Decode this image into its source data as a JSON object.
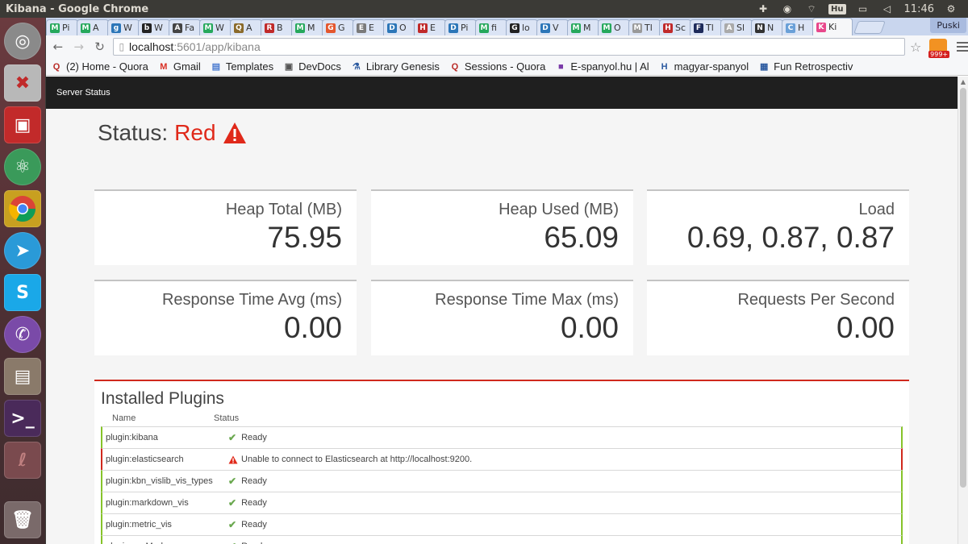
{
  "system_bar": {
    "window_title": "Kibana - Google Chrome",
    "keyboard_layout": "Hu",
    "time": "11:46"
  },
  "launcher": {
    "apps": [
      "ubuntu-icon",
      "settings-icon",
      "app-icon",
      "atom-icon",
      "chrome-icon",
      "telegram-icon",
      "skype-icon",
      "viber-icon",
      "files-icon",
      "terminal-icon",
      "app-icon",
      "trash-icon"
    ]
  },
  "tabs": [
    {
      "label": "Pi",
      "color": "#25a85c",
      "glyph": "M"
    },
    {
      "label": "A",
      "color": "#25a85c",
      "glyph": "M"
    },
    {
      "label": "W",
      "color": "#2c76b8",
      "glyph": "g"
    },
    {
      "label": "W",
      "color": "#222222",
      "glyph": "b"
    },
    {
      "label": "Fa",
      "color": "#444444",
      "glyph": "A"
    },
    {
      "label": "W",
      "color": "#25a85c",
      "glyph": "M"
    },
    {
      "label": "A",
      "color": "#8a6a2a",
      "glyph": "Q"
    },
    {
      "label": "B",
      "color": "#c02a2a",
      "glyph": "R"
    },
    {
      "label": "M",
      "color": "#25a85c",
      "glyph": "M"
    },
    {
      "label": "G",
      "color": "#e4572e",
      "glyph": "G"
    },
    {
      "label": "E",
      "color": "#7a7a7a",
      "glyph": "E"
    },
    {
      "label": "O",
      "color": "#2c76b8",
      "glyph": "D"
    },
    {
      "label": "E",
      "color": "#c02a2a",
      "glyph": "H"
    },
    {
      "label": "Pi",
      "color": "#2c76b8",
      "glyph": "D"
    },
    {
      "label": "fi",
      "color": "#25a85c",
      "glyph": "M"
    },
    {
      "label": "lo",
      "color": "#222222",
      "glyph": "G"
    },
    {
      "label": "V",
      "color": "#2c76b8",
      "glyph": "D"
    },
    {
      "label": "M",
      "color": "#25a85c",
      "glyph": "M"
    },
    {
      "label": "O",
      "color": "#25a85c",
      "glyph": "M"
    },
    {
      "label": "Tl",
      "color": "#999999",
      "glyph": "M"
    },
    {
      "label": "Sc",
      "color": "#c02a2a",
      "glyph": "H"
    },
    {
      "label": "Tl",
      "color": "#1d2a5a",
      "glyph": "F"
    },
    {
      "label": "Sl",
      "color": "#aaaaaa",
      "glyph": "A"
    },
    {
      "label": "N",
      "color": "#333333",
      "glyph": "N"
    },
    {
      "label": "H",
      "color": "#6aa0d8",
      "glyph": "C"
    },
    {
      "label": "Ki",
      "color": "#e8478b",
      "glyph": "K"
    }
  ],
  "profile_name": "Puski",
  "address_bar": {
    "host": "localhost",
    "path": ":5601/app/kibana"
  },
  "extension_badge": "999+",
  "bookmarks": [
    {
      "label": "(2) Home - Quora",
      "icon": "Q",
      "color": "#b92b27"
    },
    {
      "label": "Gmail",
      "icon": "M",
      "color": "#d93025"
    },
    {
      "label": "Templates",
      "icon": "▤",
      "color": "#4a7bd0"
    },
    {
      "label": "DevDocs",
      "icon": "▣",
      "color": "#555555"
    },
    {
      "label": "Library Genesis",
      "icon": "⚗",
      "color": "#2c5aa0"
    },
    {
      "label": "Sessions - Quora",
      "icon": "Q",
      "color": "#b92b27"
    },
    {
      "label": "E-spanyol.hu | Al",
      "icon": "■",
      "color": "#7a3aa8"
    },
    {
      "label": "magyar-spanyol",
      "icon": "H",
      "color": "#2c5aa0"
    },
    {
      "label": "Fun Retrospectiv",
      "icon": "▦",
      "color": "#2c5aa0"
    }
  ],
  "kibana": {
    "nav_label": "Server Status",
    "status_label": "Status:",
    "status_value": "Red",
    "metrics": [
      {
        "label": "Heap Total (MB)",
        "value": "75.95"
      },
      {
        "label": "Heap Used (MB)",
        "value": "65.09"
      },
      {
        "label": "Load",
        "value": "0.69, 0.87, 0.87"
      },
      {
        "label": "Response Time Avg (ms)",
        "value": "0.00"
      },
      {
        "label": "Response Time Max (ms)",
        "value": "0.00"
      },
      {
        "label": "Requests Per Second",
        "value": "0.00"
      }
    ],
    "plugins_title": "Installed Plugins",
    "columns": {
      "name": "Name",
      "status": "Status"
    },
    "plugins": [
      {
        "name": "plugin:kibana",
        "status": "Ready",
        "state": "green"
      },
      {
        "name": "plugin:elasticsearch",
        "status": "Unable to connect to Elasticsearch at http://localhost:9200.",
        "state": "red"
      },
      {
        "name": "plugin:kbn_vislib_vis_types",
        "status": "Ready",
        "state": "green"
      },
      {
        "name": "plugin:markdown_vis",
        "status": "Ready",
        "state": "green"
      },
      {
        "name": "plugin:metric_vis",
        "status": "Ready",
        "state": "green"
      },
      {
        "name": "plugin:spyModes",
        "status": "Ready",
        "state": "green"
      }
    ]
  },
  "colors": {
    "status_red": "#e0291a",
    "ready_green": "#86c32a",
    "nav_bg": "#1f1f1f"
  }
}
